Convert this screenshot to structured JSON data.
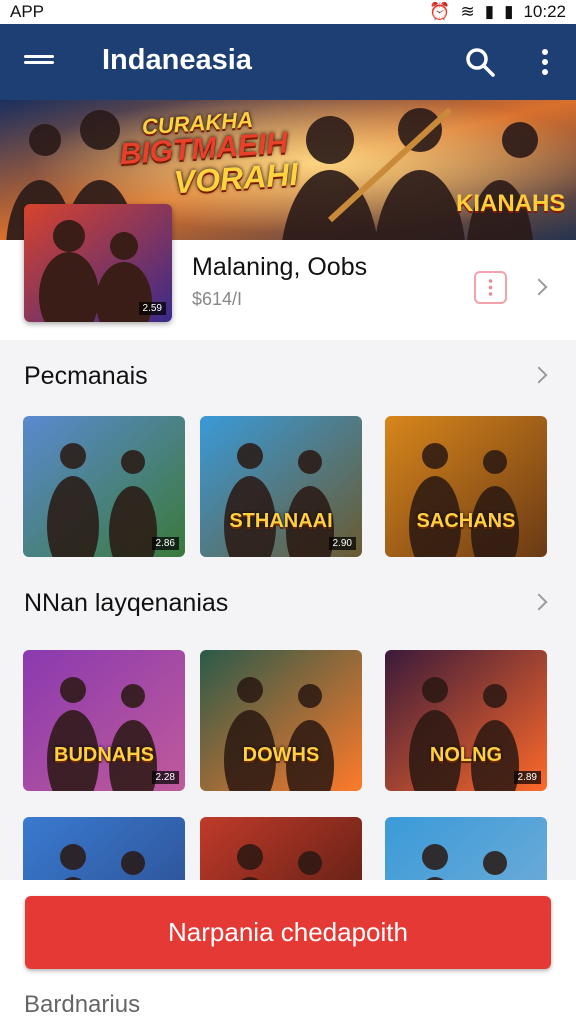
{
  "status_bar": {
    "app_label": "APP",
    "time": "10:22"
  },
  "app_bar": {
    "title": "Indaneasia"
  },
  "banner": {
    "headline_1": "CURAKHA",
    "headline_2": "BIGTMAEIH",
    "headline_3": "VORAHI",
    "logo": "KIANAHS"
  },
  "featured": {
    "title": "Malaning, Oobs",
    "subtitle": "$614/I",
    "thumb_price": "2.59"
  },
  "sections": [
    {
      "title": "Pecmanais",
      "cards": [
        {
          "badge": "",
          "price": "2.86",
          "name": "",
          "colors": [
            "#5a8ad0",
            "#3a7a3a"
          ]
        },
        {
          "badge": "",
          "price": "2.90",
          "name": "STHANAAI",
          "colors": [
            "#3a9ad8",
            "#6a5a30"
          ]
        },
        {
          "badge": "",
          "price": "",
          "name": "SACHANS",
          "colors": [
            "#d8861c",
            "#6a3a14"
          ]
        }
      ]
    },
    {
      "title": "NNan layqenanias",
      "cards": [
        {
          "badge": "",
          "price": "2.28",
          "name": "BUDNAHS",
          "colors": [
            "#8a3ab0",
            "#c05a9a"
          ]
        },
        {
          "badge": "",
          "price": "",
          "name": "DOWHS",
          "colors": [
            "#2a5a4a",
            "#ff7a2a"
          ]
        },
        {
          "badge": "",
          "price": "2.89",
          "name": "NOLNG",
          "colors": [
            "#3a1a3a",
            "#ff6a2a"
          ]
        }
      ]
    },
    {
      "title": "",
      "cards": [
        {
          "badge": "",
          "price": "",
          "name": "",
          "colors": [
            "#3a7ad0",
            "#2a4a8a"
          ]
        },
        {
          "badge": "",
          "price": "",
          "name": "",
          "colors": [
            "#c03a2a",
            "#4a1a10"
          ]
        },
        {
          "badge": "",
          "price": "",
          "name": "",
          "colors": [
            "#3a9ad8",
            "#7ab0d8"
          ]
        }
      ]
    }
  ],
  "cta": {
    "label": "Narpania chedapoith"
  },
  "footer": {
    "label": "Bardnarius"
  },
  "colors": {
    "app_bar": "#1e3f74",
    "cta": "#e53935"
  }
}
